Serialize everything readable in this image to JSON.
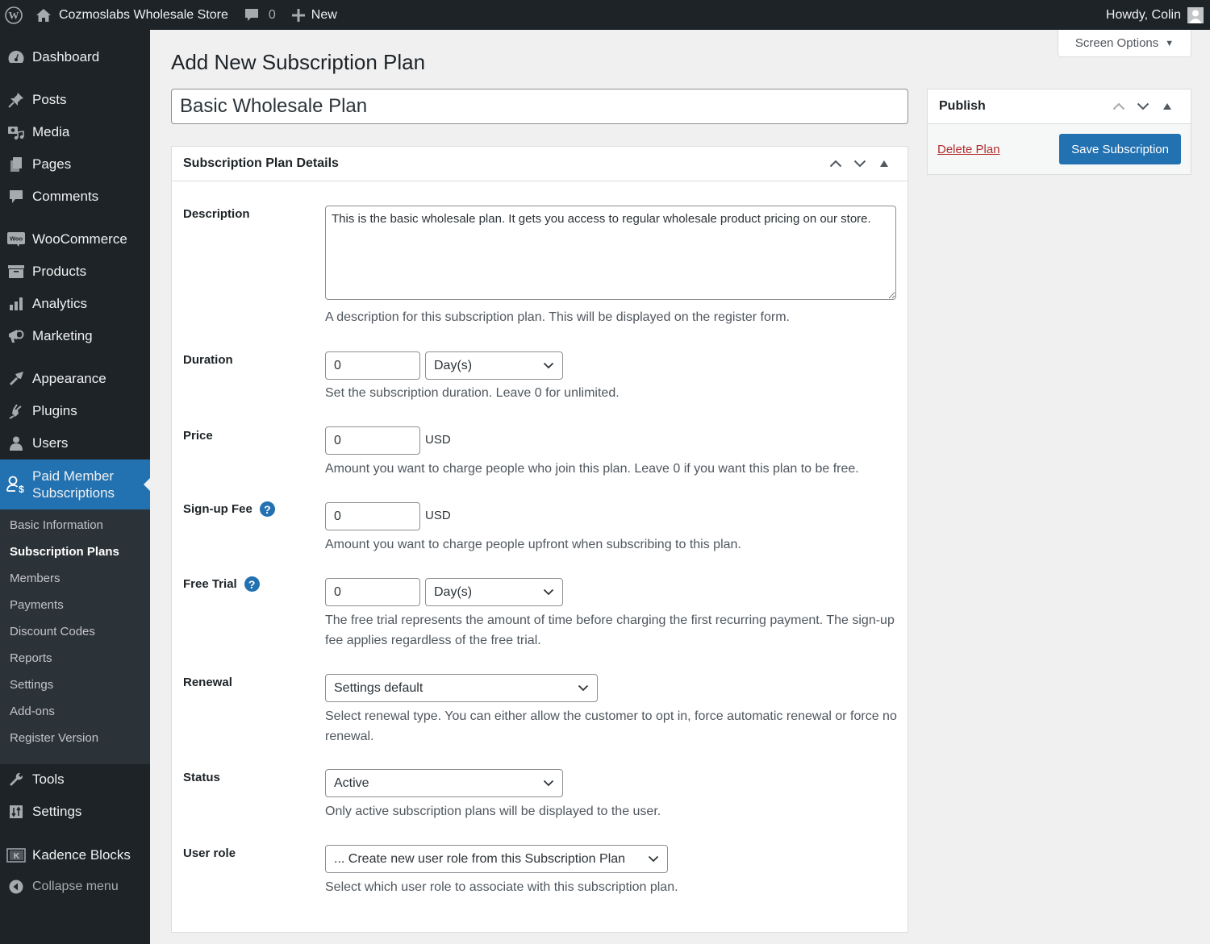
{
  "adminbar": {
    "site_name": "Cozmoslabs Wholesale Store",
    "comments_count": "0",
    "new_label": "New",
    "greeting": "Howdy, Colin"
  },
  "sidebar": {
    "items": [
      {
        "label": "Dashboard",
        "icon": "dashboard-icon"
      },
      {
        "label": "Posts",
        "icon": "pin-icon"
      },
      {
        "label": "Media",
        "icon": "media-icon"
      },
      {
        "label": "Pages",
        "icon": "pages-icon"
      },
      {
        "label": "Comments",
        "icon": "comment-icon"
      },
      {
        "label": "WooCommerce",
        "icon": "woo-icon"
      },
      {
        "label": "Products",
        "icon": "archive-icon"
      },
      {
        "label": "Analytics",
        "icon": "bar-chart-icon"
      },
      {
        "label": "Marketing",
        "icon": "megaphone-icon"
      },
      {
        "label": "Appearance",
        "icon": "brush-icon"
      },
      {
        "label": "Plugins",
        "icon": "plug-icon"
      },
      {
        "label": "Users",
        "icon": "user-icon"
      },
      {
        "label": "Paid Member Subscriptions",
        "label_line1": "Paid Member",
        "label_line2": "Subscriptions",
        "icon": "member-dollar-icon",
        "current": true
      },
      {
        "label": "Tools",
        "icon": "wrench-icon"
      },
      {
        "label": "Settings",
        "icon": "sliders-icon"
      },
      {
        "label": "Kadence Blocks",
        "icon": "kadence-icon"
      },
      {
        "label": "Collapse menu",
        "icon": "collapse-icon"
      }
    ],
    "submenu": [
      {
        "label": "Basic Information"
      },
      {
        "label": "Subscription Plans",
        "active": true
      },
      {
        "label": "Members"
      },
      {
        "label": "Payments"
      },
      {
        "label": "Discount Codes"
      },
      {
        "label": "Reports"
      },
      {
        "label": "Settings"
      },
      {
        "label": "Add-ons"
      },
      {
        "label": "Register Version"
      }
    ]
  },
  "screen_options": {
    "label": "Screen Options"
  },
  "page": {
    "title": "Add New Subscription Plan",
    "plan_name": "Basic Wholesale Plan"
  },
  "details": {
    "heading": "Subscription Plan Details",
    "fields": {
      "description": {
        "label": "Description",
        "value": "This is the basic wholesale plan. It gets you access to regular wholesale product pricing on our store.",
        "help": "A description for this subscription plan. This will be displayed on the register form."
      },
      "duration": {
        "label": "Duration",
        "value": "0",
        "unit": "Day(s)",
        "help": "Set the subscription duration. Leave 0 for unlimited."
      },
      "price": {
        "label": "Price",
        "value": "0",
        "currency": "USD",
        "help": "Amount you want to charge people who join this plan. Leave 0 if you want this plan to be free."
      },
      "signup_fee": {
        "label": "Sign-up Fee",
        "value": "0",
        "currency": "USD",
        "help": "Amount you want to charge people upfront when subscribing to this plan."
      },
      "free_trial": {
        "label": "Free Trial",
        "value": "0",
        "unit": "Day(s)",
        "help": "The free trial represents the amount of time before charging the first recurring payment. The sign-up fee applies regardless of the free trial."
      },
      "renewal": {
        "label": "Renewal",
        "value": "Settings default",
        "help": "Select renewal type. You can either allow the customer to opt in, force automatic renewal or force no renewal."
      },
      "status": {
        "label": "Status",
        "value": "Active",
        "help": "Only active subscription plans will be displayed to the user."
      },
      "user_role": {
        "label": "User role",
        "value": "... Create new user role from this Subscription Plan",
        "help": "Select which user role to associate with this subscription plan."
      }
    }
  },
  "publish": {
    "heading": "Publish",
    "delete_label": "Delete Plan",
    "save_label": "Save Subscription"
  },
  "colors": {
    "admin_bg": "#1d2327",
    "accent": "#2271b1",
    "delete": "#b32d2e",
    "submenu_bg": "#2c3338"
  }
}
